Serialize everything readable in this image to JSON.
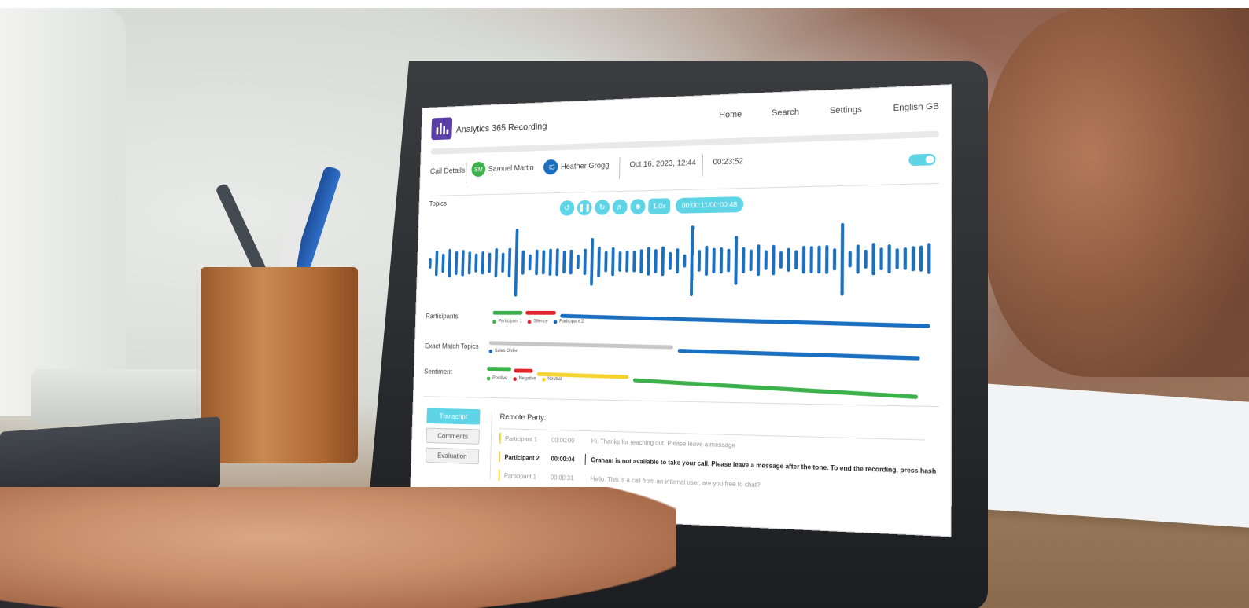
{
  "app": {
    "title": "Analytics 365 Recording",
    "nav": [
      "Home",
      "Search",
      "Settings",
      "English GB"
    ]
  },
  "call_details": {
    "label": "Call Details",
    "participant_a": {
      "initials": "SM",
      "name": "Samuel Martin",
      "color": "#3cb04a"
    },
    "participant_b": {
      "initials": "HG",
      "name": "Heather Grogg",
      "color": "#1a6fc0"
    },
    "datetime": "Oct 16, 2023, 12:44",
    "duration": "00:23:52",
    "toggle_on": true
  },
  "topics_label": "Topics",
  "player": {
    "speed": "1.0x",
    "time": "00:00:11/00:00:48",
    "icons": [
      "rewind-icon",
      "pause-icon",
      "forward-icon",
      "volume-icon",
      "add-participant-icon"
    ]
  },
  "tracks": {
    "participants": {
      "label": "Participants",
      "legend": [
        {
          "name": "Participant 1",
          "color": "#3cb04a"
        },
        {
          "name": "Silence",
          "color": "#e0262d"
        },
        {
          "name": "Participant 2",
          "color": "#1a6fc0"
        }
      ]
    },
    "exact_match": {
      "label": "Exact Match Topics",
      "legend": [
        {
          "name": "Sales Order",
          "color": "#1a6fc0"
        }
      ]
    },
    "sentiment": {
      "label": "Sentiment",
      "legend": [
        {
          "name": "Positive",
          "color": "#3cb04a"
        },
        {
          "name": "Negative",
          "color": "#e0262d"
        },
        {
          "name": "Neutral",
          "color": "#f5d32e"
        }
      ]
    }
  },
  "tabs": [
    "Transcript",
    "Comments",
    "Evaluation"
  ],
  "transcript": {
    "heading": "Remote Party:",
    "rows": [
      {
        "who": "Participant 1",
        "ts": "00:00:00",
        "text": "Hi. Thanks for reaching out. Please leave a message"
      },
      {
        "who": "Participant 2",
        "ts": "00:00:04",
        "text": "Graham is not available to take your call. Please leave a message after the tone. To end the recording, press hash"
      },
      {
        "who": "Participant 1",
        "ts": "00:00:31",
        "text": "Hello. This is a call from an internal user, are you free to chat?"
      }
    ]
  },
  "colors": {
    "accent": "#5ed4e6",
    "wave": "#1a6fc0",
    "brand": "#5b3fa8"
  }
}
